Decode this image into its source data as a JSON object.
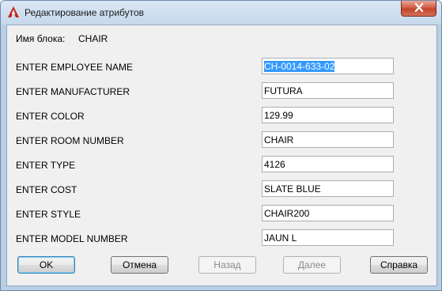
{
  "window": {
    "title": "Редактирование атрибутов",
    "close_icon": "close-x-icon",
    "app_icon": "autocad-logo-icon"
  },
  "block": {
    "label": "Имя блока:",
    "value": "CHAIR"
  },
  "attributes": [
    {
      "label": "ENTER EMPLOYEE NAME",
      "value": "CH-0014-633-02"
    },
    {
      "label": "ENTER MANUFACTURER",
      "value": "FUTURA"
    },
    {
      "label": "ENTER COLOR",
      "value": "129.99"
    },
    {
      "label": "ENTER ROOM NUMBER",
      "value": "CHAIR"
    },
    {
      "label": "ENTER TYPE",
      "value": "4126"
    },
    {
      "label": "ENTER COST",
      "value": "SLATE BLUE"
    },
    {
      "label": "ENTER STYLE",
      "value": "CHAIR200"
    },
    {
      "label": "ENTER MODEL NUMBER",
      "value": "JAUN L"
    }
  ],
  "buttons": {
    "ok": "OK",
    "cancel": "Отмена",
    "back": "Назад",
    "next": "Далее",
    "help": "Справка"
  },
  "colors": {
    "selection": "#3399ff",
    "close_button": "#c2432a",
    "default_button_border": "#3c7fb1"
  }
}
